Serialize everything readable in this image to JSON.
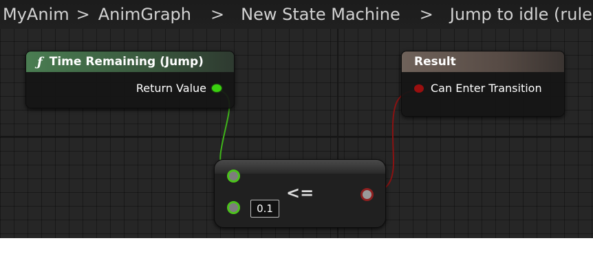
{
  "breadcrumb": {
    "items": [
      "MyAnim",
      "AnimGraph",
      "New State Machine",
      "Jump to idle (rule)"
    ],
    "separator": ">"
  },
  "node_time_remaining": {
    "title": "Time Remaining (Jump)",
    "icon": "function-icon",
    "icon_glyph": "ƒ",
    "output_pin": "Return Value"
  },
  "node_result": {
    "title": "Result",
    "input_pin": "Can Enter Transition"
  },
  "node_compare": {
    "operator": "<=",
    "default_value": "0.1"
  },
  "colors": {
    "float_pin": "#3ad10f",
    "bool_pin": "#9a0f0f",
    "graph_background": "#262626"
  }
}
